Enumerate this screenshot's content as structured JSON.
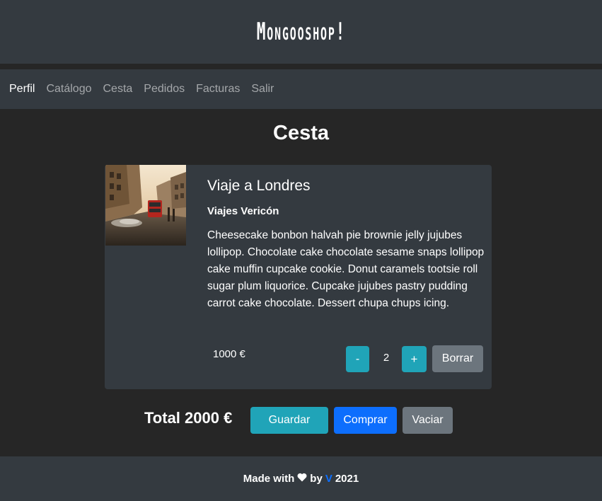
{
  "header": {
    "brand": "Mongooshop!"
  },
  "nav": {
    "items": [
      {
        "label": "Perfil"
      },
      {
        "label": "Catálogo"
      },
      {
        "label": "Cesta"
      },
      {
        "label": "Pedidos"
      },
      {
        "label": "Facturas"
      },
      {
        "label": "Salir"
      }
    ]
  },
  "page": {
    "title": "Cesta"
  },
  "cart_item": {
    "title": "Viaje a Londres",
    "vendor": "Viajes Vericón",
    "description": "Cheesecake bonbon halvah pie brownie jelly jujubes lollipop. Chocolate cake chocolate sesame snaps lollipop cake muffin cupcake cookie. Donut caramels tootsie roll sugar plum liquorice. Cupcake jujubes pastry pudding carrot cake chocolate. Dessert chupa chups icing.",
    "price": "1000 €",
    "quantity": "2",
    "decrement_label": "-",
    "increment_label": "+",
    "delete_label": "Borrar"
  },
  "summary": {
    "total": "Total 2000 €",
    "save_label": "Guardar",
    "buy_label": "Comprar",
    "empty_label": "Vaciar"
  },
  "footer": {
    "made_with": "Made with",
    "by": "by",
    "author": "V",
    "year": "2021"
  },
  "colors": {
    "background": "#262626",
    "panel": "#343a40",
    "info": "#20a4b8",
    "primary": "#0d6efd",
    "secondary": "#6c757d"
  }
}
